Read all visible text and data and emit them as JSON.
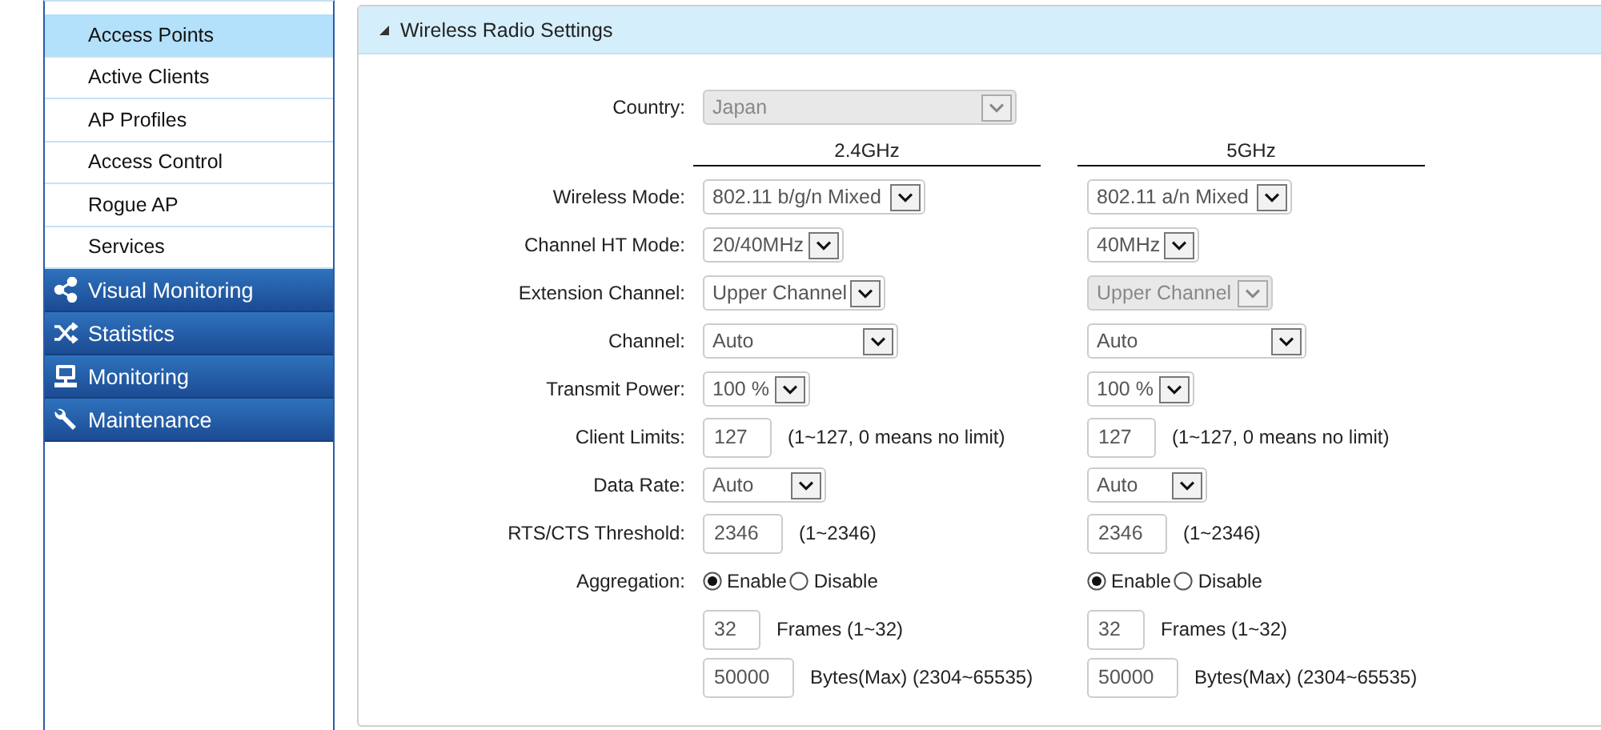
{
  "sidebar": {
    "items": [
      {
        "label": "Access Points",
        "selected": true
      },
      {
        "label": "Active Clients",
        "selected": false
      },
      {
        "label": "AP Profiles",
        "selected": false
      },
      {
        "label": "Access Control",
        "selected": false
      },
      {
        "label": "Rogue AP",
        "selected": false
      },
      {
        "label": "Services",
        "selected": false
      }
    ],
    "groups": [
      {
        "label": "Visual Monitoring",
        "kind": "share"
      },
      {
        "label": "Statistics",
        "kind": "shuffle"
      },
      {
        "label": "Monitoring",
        "kind": "monitor"
      },
      {
        "label": "Maintenance",
        "kind": "wrench"
      }
    ]
  },
  "panel": {
    "title": "Wireless Radio Settings",
    "expanded": true,
    "country": {
      "label": "Country:",
      "value": "Japan",
      "disabled": true
    },
    "columns": [
      "2.4GHz",
      "5GHz"
    ],
    "rows": [
      {
        "label": "Wireless Mode:",
        "kind": "select",
        "cells": [
          {
            "value": "802.11 b/g/n Mixed",
            "disabled": false
          },
          {
            "value": "802.11 a/n Mixed",
            "disabled": false
          }
        ]
      },
      {
        "label": "Channel HT Mode:",
        "kind": "select",
        "cells": [
          {
            "value": "20/40MHz",
            "disabled": false
          },
          {
            "value": "40MHz",
            "disabled": false
          }
        ]
      },
      {
        "label": "Extension Channel:",
        "kind": "select",
        "cells": [
          {
            "value": "Upper Channel",
            "disabled": false
          },
          {
            "value": "Upper Channel",
            "disabled": true
          }
        ]
      },
      {
        "label": "Channel:",
        "kind": "select",
        "cells": [
          {
            "value": "Auto",
            "disabled": false
          },
          {
            "value": "Auto",
            "disabled": false
          }
        ]
      },
      {
        "label": "Transmit Power:",
        "kind": "select",
        "cells": [
          {
            "value": "100 %",
            "disabled": false
          },
          {
            "value": "100 %",
            "disabled": false
          }
        ]
      },
      {
        "label": "Client Limits:",
        "kind": "input",
        "cells": [
          {
            "value": "127",
            "note": "(1~127, 0 means no limit)"
          },
          {
            "value": "127",
            "note": "(1~127, 0 means no limit)"
          }
        ]
      },
      {
        "label": "Data Rate:",
        "kind": "select",
        "cells": [
          {
            "value": "Auto",
            "disabled": false
          },
          {
            "value": "Auto",
            "disabled": false
          }
        ]
      },
      {
        "label": "RTS/CTS Threshold:",
        "kind": "input",
        "cells": [
          {
            "value": "2346",
            "note": "(1~2346)"
          },
          {
            "value": "2346",
            "note": "(1~2346)"
          }
        ]
      },
      {
        "label": "Aggregation:",
        "kind": "radio",
        "cells": [
          {
            "options": [
              {
                "label": "Enable",
                "selected": true
              },
              {
                "label": "Disable",
                "selected": false
              }
            ]
          },
          {
            "options": [
              {
                "label": "Enable",
                "selected": true
              },
              {
                "label": "Disable",
                "selected": false
              }
            ]
          }
        ]
      },
      {
        "kind": "input",
        "cells": [
          {
            "value": "32",
            "note": "Frames (1~32)"
          },
          {
            "value": "32",
            "note": "Frames (1~32)"
          }
        ]
      },
      {
        "kind": "input",
        "cells": [
          {
            "value": "50000",
            "note": "Bytes(Max) (2304~65535)"
          },
          {
            "value": "50000",
            "note": "Bytes(Max) (2304~65535)"
          }
        ]
      }
    ]
  }
}
